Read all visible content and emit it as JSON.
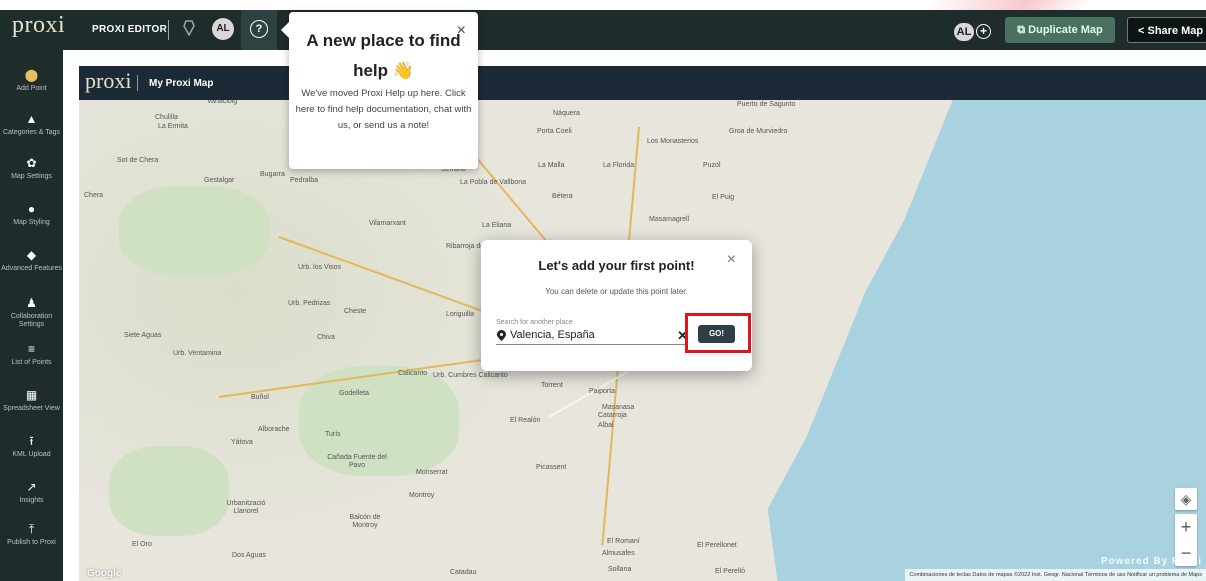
{
  "topbar": {
    "logo": "proxi",
    "editor_label": "PROXI EDITOR",
    "avatar_initials": "AL",
    "help_icon": "question-circle-icon",
    "right_avatar_initials": "AL",
    "duplicate_label": "Duplicate Map",
    "share_label": "Share Map"
  },
  "sidebar": {
    "items": [
      {
        "label": "Add Point",
        "icon": "map-pin-plus-icon"
      },
      {
        "label": "Categories & Tags",
        "icon": "shapes-icon"
      },
      {
        "label": "Map Settings",
        "icon": "gear-icon"
      },
      {
        "label": "Map Styling",
        "icon": "palette-icon"
      },
      {
        "label": "Advanced Features",
        "icon": "tags-icon"
      },
      {
        "label": "Collaboration Settings",
        "icon": "user-plus-icon"
      },
      {
        "label": "List of Points",
        "icon": "list-icon"
      },
      {
        "label": "Spreadsheet View",
        "icon": "table-icon"
      },
      {
        "label": "KML Upload",
        "icon": "upload-icon"
      },
      {
        "label": "Insights",
        "icon": "trend-icon"
      },
      {
        "label": "Publish to Proxi",
        "icon": "publish-icon"
      }
    ]
  },
  "map": {
    "logo": "proxi",
    "title": "My Proxi Map",
    "towns": [
      "Vanacloig",
      "Chulilla",
      "La Ermita",
      "Sot de Chera",
      "Gestalgar",
      "Bugarra",
      "Pedralba",
      "Chera",
      "Náquera",
      "Puerto de Sagunto",
      "Porta Coeli",
      "Los Monasterios",
      "Groa de Murviedro",
      "Serrano",
      "La Pobla de Vallbona",
      "La Malla",
      "La Florida",
      "Puzol",
      "Bétera",
      "El Puig",
      "Vilamarxant",
      "La Eliana",
      "Masamagrell",
      "Ribarroja de Turia",
      "Urb. los Visos",
      "Urb. Pedrizas",
      "Cheste",
      "Loriguilla",
      "Siete Aguas",
      "Chiva",
      "Urb. Ventamina",
      "Calicanto",
      "Urb. Cumbres Calicanto",
      "Torrent",
      "Paiporta",
      "Buñol",
      "Godelleta",
      "Masanasa",
      "Catarroja",
      "Albal",
      "El Realón",
      "Alborache",
      "Turís",
      "Yátova",
      "Cañada Fuente del Pavo",
      "Monserrat",
      "Picassent",
      "Montroy",
      "Urbanització Llanorel",
      "Balcón de Montroy",
      "El Oro",
      "Dos Aguas",
      "El Romaní",
      "Almusafes",
      "El Perellonet",
      "Catadau",
      "Sollana",
      "El Perelló"
    ],
    "powered_by": "Powered By Proxi",
    "attribution": "Combinaciones de teclas   Datos de mapas ©2022 Inst. Geogr. Nacional   Términos de uso   Notificar un problema de Maps",
    "google": "Google",
    "zoom_in": "+",
    "zoom_out": "−"
  },
  "help_popup": {
    "title": "A new place to find help 👋",
    "body": "We've moved Proxi Help up here. Click here to find help documentation, chat with us, or send us a note!",
    "close": "×"
  },
  "modal": {
    "title": "Let's add your first point!",
    "subtitle": "You can delete or update this point later.",
    "search_label": "Search for another place",
    "search_value": "Valencia, España",
    "go_label": "GO!",
    "close": "×"
  },
  "colors": {
    "sidebar_bg": "#1e2c2c",
    "map_header_bg": "#1b2a36",
    "duplicate_bg": "#4a7060",
    "highlight": "#e0141c",
    "sea": "#a9d2e0"
  }
}
